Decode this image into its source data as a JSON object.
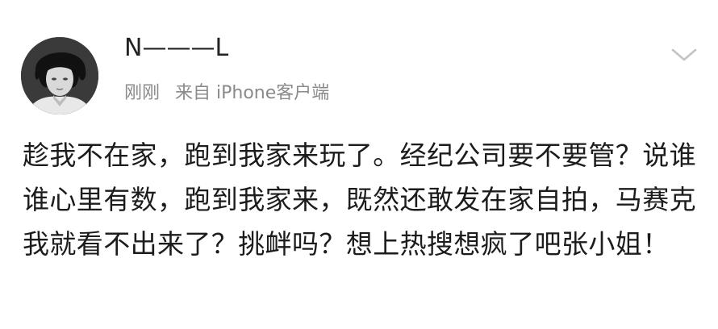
{
  "post": {
    "username": "N———L",
    "time": "刚刚",
    "source": "来自 iPhone客户端",
    "menu_icon": "chevron-down-icon",
    "avatar_icon": "avatar",
    "content": "趁我不在家，跑到我家来玩了。经纪公司要不要管？说谁谁心里有数，跑到我家来，既然还敢发在家自拍，马赛克我就看不出来了？挑衅吗？想上热搜想疯了吧张小姐！"
  }
}
